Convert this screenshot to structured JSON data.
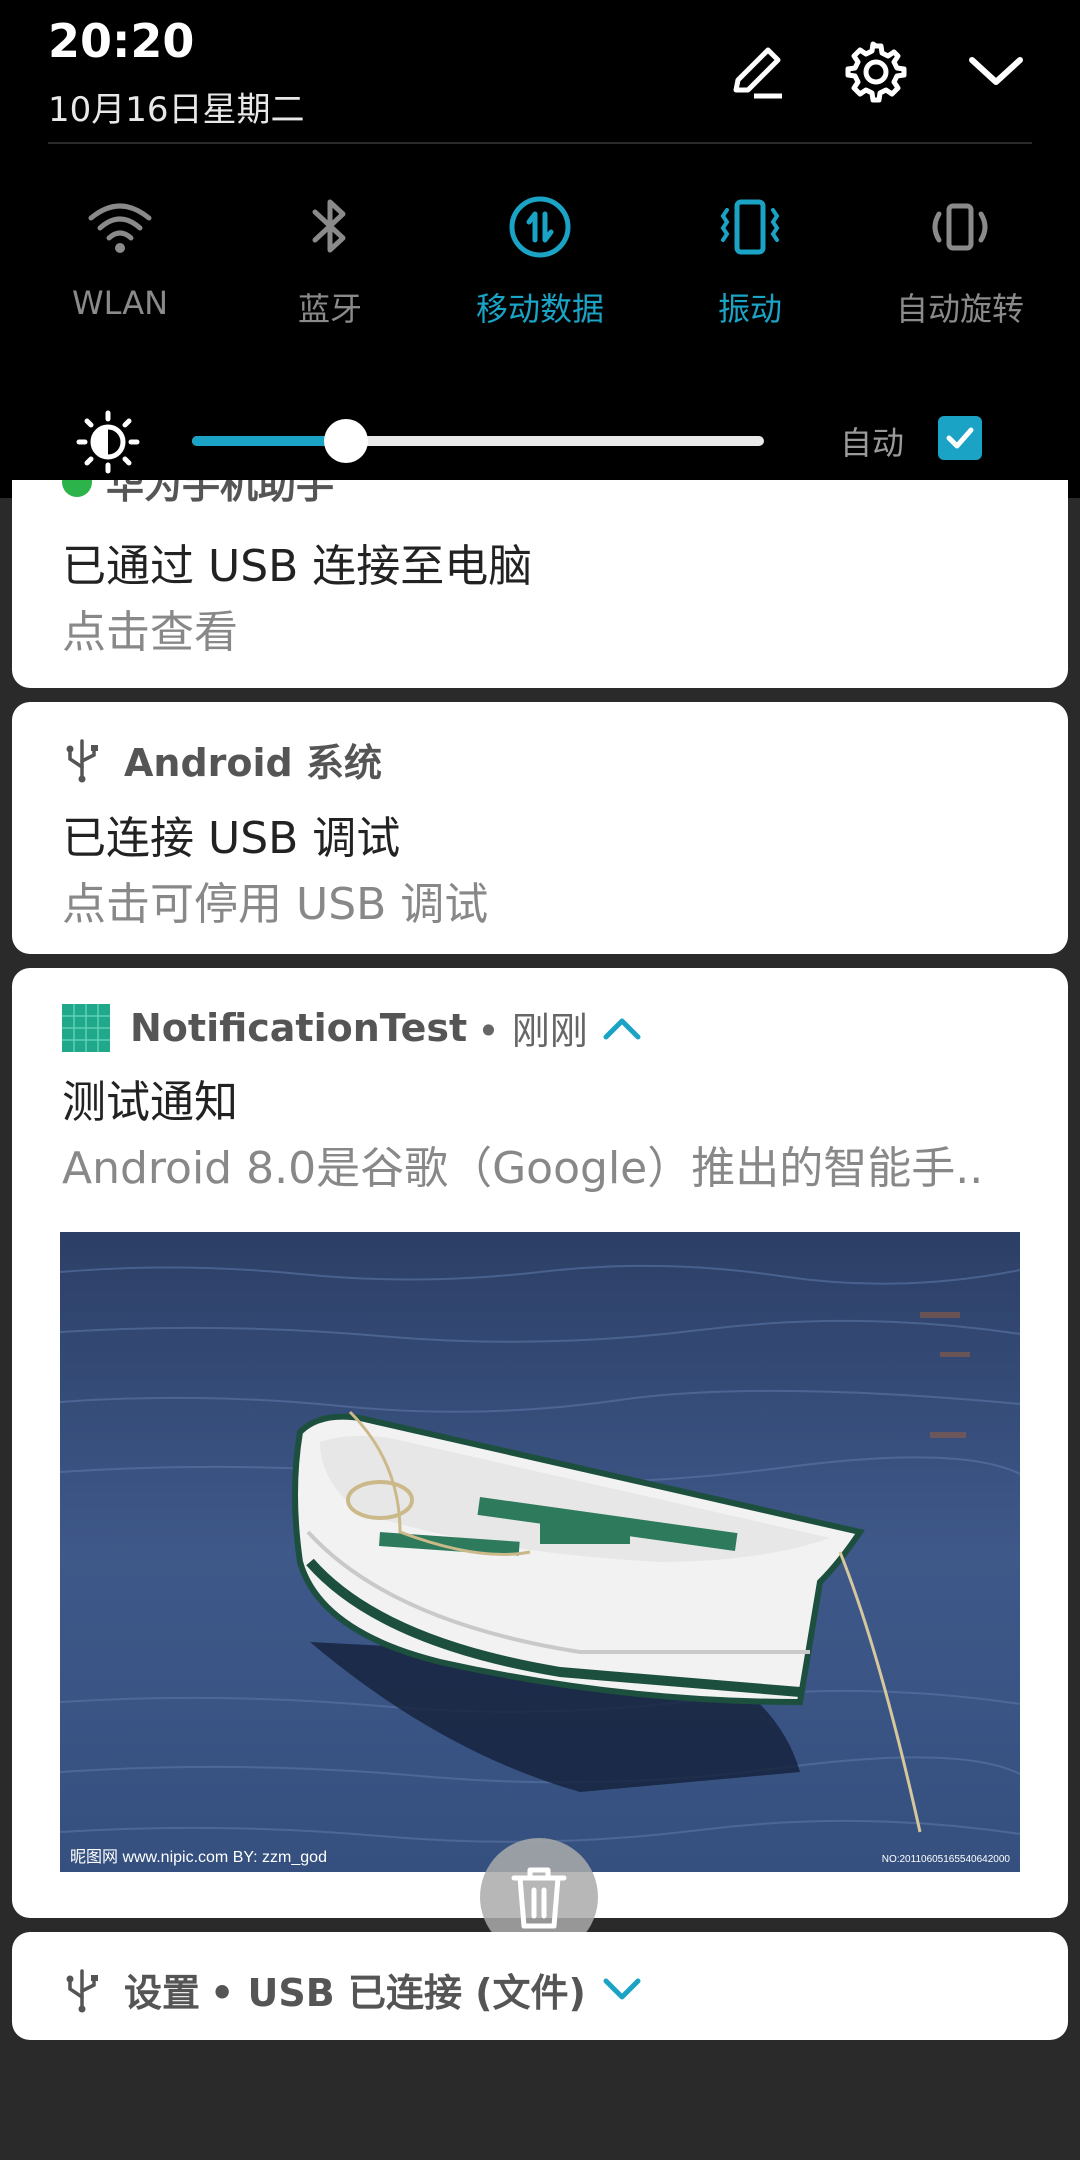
{
  "status": {
    "time": "20:20",
    "date": "10月16日星期二"
  },
  "header_icons": [
    "edit-icon",
    "settings-gear-icon",
    "collapse-chevron-icon"
  ],
  "tiles": [
    {
      "label": "WLAN",
      "icon": "wifi-icon",
      "active": false
    },
    {
      "label": "蓝牙",
      "icon": "bluetooth-icon",
      "active": false
    },
    {
      "label": "移动数据",
      "icon": "mobile-data-icon",
      "active": true
    },
    {
      "label": "振动",
      "icon": "vibrate-icon",
      "active": true
    },
    {
      "label": "自动旋转",
      "icon": "auto-rotate-icon",
      "active": false
    }
  ],
  "brightness": {
    "level": 0.27,
    "auto_label": "自动",
    "auto_checked": true
  },
  "colors": {
    "accent": "#1aa3c5",
    "teal_icon": "#20a88a"
  },
  "notifications": {
    "usb_assistant": {
      "app_name": "华为手机助手",
      "title": "已通过 USB 连接至电脑",
      "body": "点击查看"
    },
    "android_system": {
      "app_name": "Android 系统",
      "title": "已连接 USB 调试",
      "body": "点击可停用 USB 调试"
    },
    "notification_test": {
      "app_name": "NotificationTest",
      "time": "• 刚刚",
      "title": "测试通知",
      "body": "Android 8.0是谷歌（Google）推出的智能手..",
      "image_watermark_left": "昵图网 www.nipic.com   BY: zzm_god",
      "image_watermark_right": "NO:20110605165540642000"
    },
    "settings_usb": {
      "app_name": "设置",
      "extra": "• USB 已连接 (文件)"
    }
  }
}
